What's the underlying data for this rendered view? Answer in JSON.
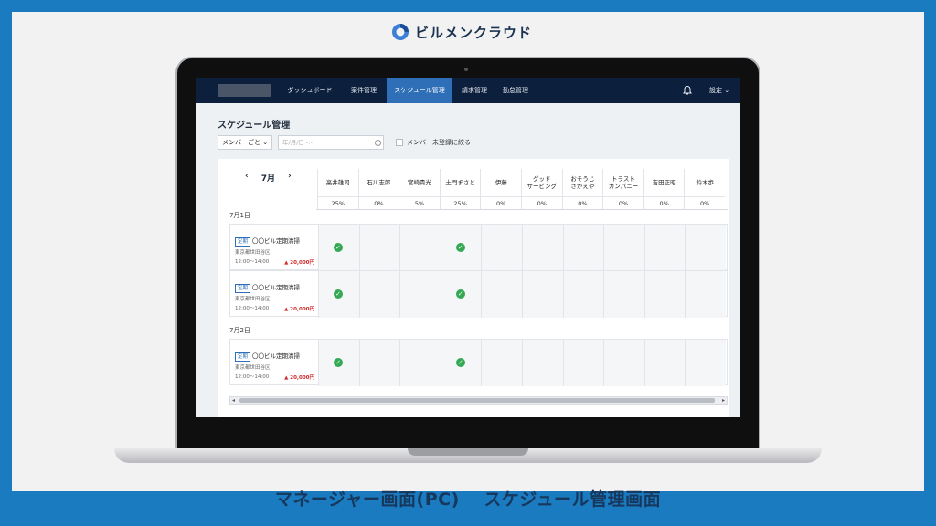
{
  "brand": {
    "name": "ビルメンクラウド"
  },
  "caption": "マネージャー画面(PC)　 スケジュール管理画面",
  "nav": {
    "items": [
      "ダッシュボード",
      "案件管理",
      "スケジュール管理",
      "請求管理",
      "勤怠管理"
    ],
    "active_index": 2,
    "settings_label": "設定"
  },
  "page": {
    "title": "スケジュール管理",
    "member_select": "メンバーごと",
    "date_placeholder": "年/月/日 -:-",
    "unregistered_filter_label": "メンバー未登録に絞る"
  },
  "schedule": {
    "month": "7月",
    "members": [
      {
        "name": "高井雄司",
        "pct": "25%"
      },
      {
        "name": "石川志郎",
        "pct": "0%"
      },
      {
        "name": "宮崎貴光",
        "pct": "5%"
      },
      {
        "name": "土門まさと",
        "pct": "25%"
      },
      {
        "name": "伊藤",
        "pct": "0%"
      },
      {
        "name": "グッド\nサービング",
        "pct": "0%"
      },
      {
        "name": "おそうじ\nさかえや",
        "pct": "0%"
      },
      {
        "name": "トラスト\nカンパニー",
        "pct": "0%"
      },
      {
        "name": "吉田正昭",
        "pct": "0%"
      },
      {
        "name": "鈴木歩",
        "pct": "0%"
      }
    ],
    "days": [
      {
        "label": "7月1日",
        "jobs": [
          {
            "tag": "定期",
            "name": "〇〇ビル定期清掃",
            "address": "東京都世田谷区",
            "time": "12:00〜14:00",
            "price": "▲ 20,000円",
            "assigned": [
              0,
              3
            ]
          },
          {
            "tag": "定期",
            "name": "〇〇ビル定期清掃",
            "address": "東京都世田谷区",
            "time": "12:00〜14:00",
            "price": "▲ 20,000円",
            "assigned": [
              0,
              3
            ]
          }
        ]
      },
      {
        "label": "7月2日",
        "jobs": [
          {
            "tag": "定期",
            "name": "〇〇ビル定期清掃",
            "address": "東京都世田谷区",
            "time": "12:00〜14:00",
            "price": "▲ 20,000円",
            "assigned": [
              0,
              3
            ]
          }
        ]
      }
    ]
  },
  "colors": {
    "frame": "#1a7bc0",
    "navbar": "#0c1f3c",
    "nav_active": "#2f6fb8",
    "check": "#34a853",
    "price": "#d12b2b"
  }
}
